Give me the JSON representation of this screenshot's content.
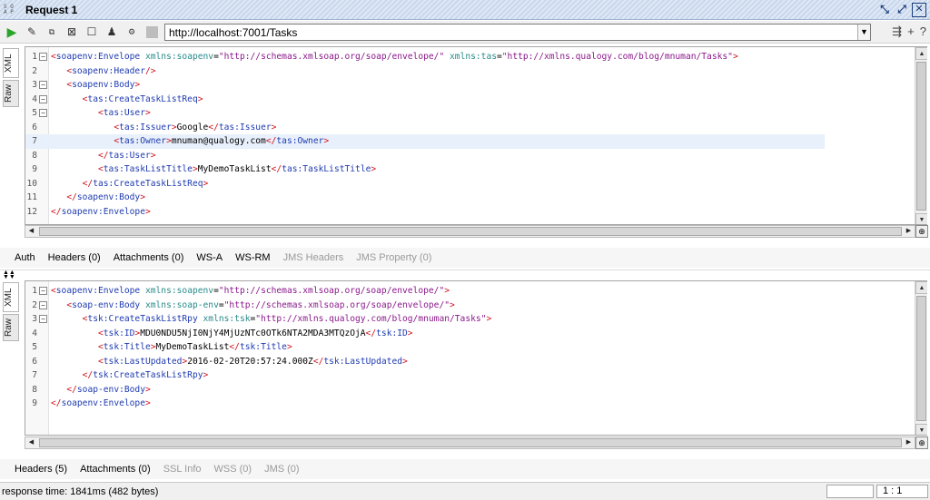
{
  "window": {
    "logo_text": [
      "S O",
      "A P"
    ],
    "title": "Request 1"
  },
  "toolbar": {
    "url": "http://localhost:7001/Tasks"
  },
  "request_editor": {
    "tabs": [
      "XML",
      "Raw"
    ],
    "lines": [
      {
        "n": "1",
        "fold": true,
        "html": "<span class='t-br'>&lt;</span><span class='t-tag'>soapenv:Envelope</span> <span class='t-att'>xmlns:soapenv</span><span class='t-eq'>=</span><span class='t-val'>\"http://schemas.xmlsoap.org/soap/envelope/\"</span> <span class='t-att'>xmlns:tas</span><span class='t-eq'>=</span><span class='t-val'>\"http://xmlns.qualogy.com/blog/mnuman/Tasks\"</span><span class='t-br'>&gt;</span>"
      },
      {
        "n": "2",
        "fold": false,
        "html": "   <span class='t-br'>&lt;</span><span class='t-tag'>soapenv:Header</span><span class='t-br'>/&gt;</span>"
      },
      {
        "n": "3",
        "fold": true,
        "html": "   <span class='t-br'>&lt;</span><span class='t-tag'>soapenv:Body</span><span class='t-br'>&gt;</span>"
      },
      {
        "n": "4",
        "fold": true,
        "html": "      <span class='t-br'>&lt;</span><span class='t-tag'>tas:CreateTaskListReq</span><span class='t-br'>&gt;</span>"
      },
      {
        "n": "5",
        "fold": true,
        "html": "         <span class='t-br'>&lt;</span><span class='t-tag'>tas:User</span><span class='t-br'>&gt;</span>"
      },
      {
        "n": "6",
        "fold": false,
        "html": "            <span class='t-br'>&lt;</span><span class='t-tag'>tas:Issuer</span><span class='t-br'>&gt;</span><span class='t-txt'>Google</span><span class='t-br'>&lt;/</span><span class='t-tag'>tas:Issuer</span><span class='t-br'>&gt;</span>"
      },
      {
        "n": "7",
        "fold": false,
        "hl": true,
        "html": "            <span class='t-br'>&lt;</span><span class='t-tag'>tas:Owner</span><span class='t-br'>&gt;</span><span class='t-txt'>mnuman@qualogy.com</span><span class='t-br'>&lt;/</span><span class='t-tag'>tas:Owner</span><span class='t-br'>&gt;</span>"
      },
      {
        "n": "8",
        "fold": false,
        "html": "         <span class='t-br'>&lt;/</span><span class='t-tag'>tas:User</span><span class='t-br'>&gt;</span>"
      },
      {
        "n": "9",
        "fold": false,
        "html": "         <span class='t-br'>&lt;</span><span class='t-tag'>tas:TaskListTitle</span><span class='t-br'>&gt;</span><span class='t-txt'>MyDemoTaskList</span><span class='t-br'>&lt;/</span><span class='t-tag'>tas:TaskListTitle</span><span class='t-br'>&gt;</span>"
      },
      {
        "n": "10",
        "fold": false,
        "html": "      <span class='t-br'>&lt;/</span><span class='t-tag'>tas:CreateTaskListReq</span><span class='t-br'>&gt;</span>"
      },
      {
        "n": "11",
        "fold": false,
        "html": "   <span class='t-br'>&lt;/</span><span class='t-tag'>soapenv:Body</span><span class='t-br'>&gt;</span>"
      },
      {
        "n": "12",
        "fold": false,
        "html": "<span class='t-br'>&lt;/</span><span class='t-tag'>soapenv:Envelope</span><span class='t-br'>&gt;</span>"
      }
    ]
  },
  "request_tabs": [
    {
      "label": "Auth",
      "enabled": true
    },
    {
      "label": "Headers (0)",
      "enabled": true
    },
    {
      "label": "Attachments (0)",
      "enabled": true
    },
    {
      "label": "WS-A",
      "enabled": true
    },
    {
      "label": "WS-RM",
      "enabled": true
    },
    {
      "label": "JMS Headers",
      "enabled": false
    },
    {
      "label": "JMS Property (0)",
      "enabled": false
    }
  ],
  "response_editor": {
    "tabs": [
      "XML",
      "Raw"
    ],
    "lines": [
      {
        "n": "1",
        "fold": true,
        "html": "<span class='t-br'>&lt;</span><span class='t-tag'>soapenv:Envelope</span> <span class='t-att'>xmlns:soapenv</span><span class='t-eq'>=</span><span class='t-val'>\"http://schemas.xmlsoap.org/soap/envelope/\"</span><span class='t-br'>&gt;</span>"
      },
      {
        "n": "2",
        "fold": true,
        "html": "   <span class='t-br'>&lt;</span><span class='t-tag'>soap-env:Body</span> <span class='t-att'>xmlns:soap-env</span><span class='t-eq'>=</span><span class='t-val'>\"http://schemas.xmlsoap.org/soap/envelope/\"</span><span class='t-br'>&gt;</span>"
      },
      {
        "n": "3",
        "fold": true,
        "html": "      <span class='t-br'>&lt;</span><span class='t-tag'>tsk:CreateTaskListRpy</span> <span class='t-att'>xmlns:tsk</span><span class='t-eq'>=</span><span class='t-val'>\"http://xmlns.qualogy.com/blog/mnuman/Tasks\"</span><span class='t-br'>&gt;</span>"
      },
      {
        "n": "4",
        "fold": false,
        "html": "         <span class='t-br'>&lt;</span><span class='t-tag'>tsk:ID</span><span class='t-br'>&gt;</span><span class='t-txt'>MDU0NDU5NjI0NjY4MjUzNTc0OTk6NTA2MDA3MTQzOjA</span><span class='t-br'>&lt;/</span><span class='t-tag'>tsk:ID</span><span class='t-br'>&gt;</span>"
      },
      {
        "n": "5",
        "fold": false,
        "html": "         <span class='t-br'>&lt;</span><span class='t-tag'>tsk:Title</span><span class='t-br'>&gt;</span><span class='t-txt'>MyDemoTaskList</span><span class='t-br'>&lt;/</span><span class='t-tag'>tsk:Title</span><span class='t-br'>&gt;</span>"
      },
      {
        "n": "6",
        "fold": false,
        "html": "         <span class='t-br'>&lt;</span><span class='t-tag'>tsk:LastUpdated</span><span class='t-br'>&gt;</span><span class='t-txt'>2016-02-20T20:57:24.000Z</span><span class='t-br'>&lt;/</span><span class='t-tag'>tsk:LastUpdated</span><span class='t-br'>&gt;</span>"
      },
      {
        "n": "7",
        "fold": false,
        "html": "      <span class='t-br'>&lt;/</span><span class='t-tag'>tsk:CreateTaskListRpy</span><span class='t-br'>&gt;</span>"
      },
      {
        "n": "8",
        "fold": false,
        "html": "   <span class='t-br'>&lt;/</span><span class='t-tag'>soap-env:Body</span><span class='t-br'>&gt;</span>"
      },
      {
        "n": "9",
        "fold": false,
        "html": "<span class='t-br'>&lt;/</span><span class='t-tag'>soapenv:Envelope</span><span class='t-br'>&gt;</span>"
      }
    ]
  },
  "response_tabs": [
    {
      "label": "Headers (5)",
      "enabled": true
    },
    {
      "label": "Attachments (0)",
      "enabled": true
    },
    {
      "label": "SSL Info",
      "enabled": false
    },
    {
      "label": "WSS (0)",
      "enabled": false
    },
    {
      "label": "JMS (0)",
      "enabled": false
    }
  ],
  "status": {
    "response_time": "response time: 1841ms (482 bytes)",
    "cursor_position": "1 : 1"
  },
  "colors": {
    "xml_bracket": "#d0141e",
    "xml_tag": "#1f3bb0",
    "xml_attribute": "#2a8a8a",
    "xml_value": "#8b1a8b"
  }
}
